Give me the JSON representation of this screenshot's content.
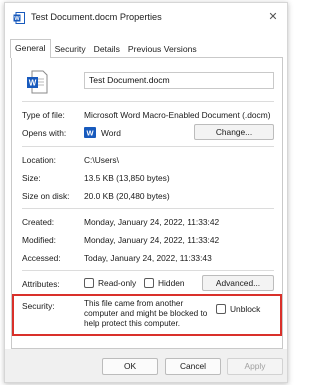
{
  "window": {
    "title": "Test Document.docm Properties",
    "close_label": "✕"
  },
  "tabs": [
    {
      "label": "General",
      "active": true
    },
    {
      "label": "Security",
      "active": false
    },
    {
      "label": "Details",
      "active": false
    },
    {
      "label": "Previous Versions",
      "active": false
    }
  ],
  "general": {
    "file_name": "Test Document.docm",
    "type_label": "Type of file:",
    "type_value": "Microsoft Word Macro-Enabled Document (.docm)",
    "opens_label": "Opens with:",
    "opens_value": "Word",
    "change_label": "Change...",
    "location_label": "Location:",
    "location_value": "C:\\Users\\",
    "size_label": "Size:",
    "size_value": "13.5 KB (13,850 bytes)",
    "size_disk_label": "Size on disk:",
    "size_disk_value": "20.0 KB (20,480 bytes)",
    "created_label": "Created:",
    "created_value": "Monday, January 24, 2022, 11:33:42",
    "modified_label": "Modified:",
    "modified_value": "Monday, January 24, 2022, 11:33:42",
    "accessed_label": "Accessed:",
    "accessed_value": "Today, January 24, 2022, 11:33:43",
    "attributes_label": "Attributes:",
    "readonly_label": "Read-only",
    "hidden_label": "Hidden",
    "advanced_label": "Advanced...",
    "security_label": "Security:",
    "security_text": "This file came from another computer and might be blocked to help protect this computer.",
    "unblock_label": "Unblock"
  },
  "footer": {
    "ok_label": "OK",
    "cancel_label": "Cancel",
    "apply_label": "Apply"
  },
  "colors": {
    "highlight": "#d9302a",
    "word_blue": "#185abd"
  },
  "icons": {
    "title": "word-document-icon",
    "file": "word-file-icon",
    "app": "word-app-icon",
    "close": "close-icon"
  }
}
